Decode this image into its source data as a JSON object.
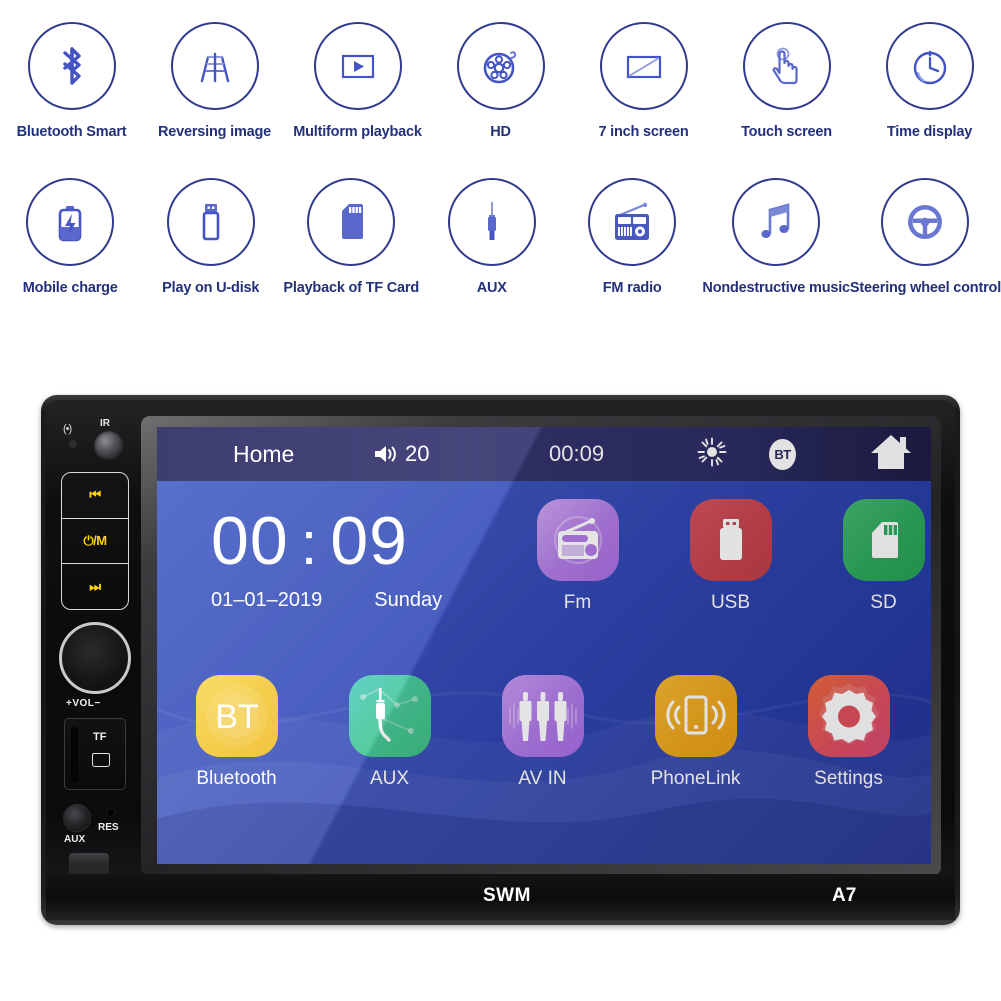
{
  "features": {
    "row1": [
      {
        "label": "Bluetooth Smart",
        "icon": "bluetooth-icon"
      },
      {
        "label": "Reversing image",
        "icon": "reversing-camera-icon"
      },
      {
        "label": "Multiform playback",
        "icon": "video-play-icon"
      },
      {
        "label": "HD",
        "icon": "film-reel-icon"
      },
      {
        "label": "7 inch screen",
        "icon": "screen-icon"
      },
      {
        "label": "Touch screen",
        "icon": "touch-hand-icon"
      },
      {
        "label": "Time display",
        "icon": "stopwatch-icon"
      }
    ],
    "row2": [
      {
        "label": "Mobile charge",
        "icon": "battery-charge-icon"
      },
      {
        "label": "Play on U-disk",
        "icon": "usb-stick-icon"
      },
      {
        "label": "Playback of TF Card",
        "icon": "sd-card-icon"
      },
      {
        "label": "AUX",
        "icon": "aux-plug-icon"
      },
      {
        "label": "FM radio",
        "icon": "radio-icon"
      },
      {
        "label": "Nondestructive music",
        "icon": "music-note-icon"
      },
      {
        "label": "Steering wheel control",
        "icon": "steering-wheel-icon"
      }
    ],
    "accent_color": "#3a47b0",
    "label_color": "#23307a"
  },
  "unit": {
    "controls": {
      "mic_symbol": "(•)",
      "ir_label": "IR",
      "prev_button": "⏮",
      "power_button": "⏻/M",
      "next_button": "⏭",
      "volume_label": "+VOL−",
      "tf_label": "TF",
      "aux_label": "AUX",
      "res_label": "RES"
    },
    "brand": {
      "name": "SWM",
      "model": "A7"
    }
  },
  "screen": {
    "statusbar": {
      "home_label": "Home",
      "volume_icon": "speaker-icon",
      "volume_value": "20",
      "time": "00:09",
      "brightness_icon": "brightness-icon",
      "bluetooth_badge": "BT",
      "home_icon": "home-icon"
    },
    "clock": {
      "hours": "00",
      "separator": ":",
      "minutes": "09",
      "date": "01–01–2019",
      "weekday": "Sunday"
    },
    "apps_row1": [
      {
        "label": "Fm",
        "icon": "radio-icon",
        "color": "#b98ce8"
      },
      {
        "label": "USB",
        "icon": "usb-stick-icon",
        "color": "#cf4a56"
      },
      {
        "label": "SD",
        "icon": "sd-card-icon",
        "color": "#2eab5d"
      }
    ],
    "apps_row2": [
      {
        "label": "Bluetooth",
        "icon": "bt-badge-icon",
        "color": "#f5ce3e"
      },
      {
        "label": "AUX",
        "icon": "aux-plug-icon",
        "color": "#45c78f"
      },
      {
        "label": "AV IN",
        "icon": "rca-plugs-icon",
        "color": "#b07ae8"
      },
      {
        "label": "PhoneLink",
        "icon": "phone-link-icon",
        "color": "#f0a81e"
      },
      {
        "label": "Settings",
        "icon": "gear-icon",
        "color": "#e2525f"
      }
    ],
    "background_color": "#3147b4",
    "statusbar_color": "#2d2d66"
  }
}
